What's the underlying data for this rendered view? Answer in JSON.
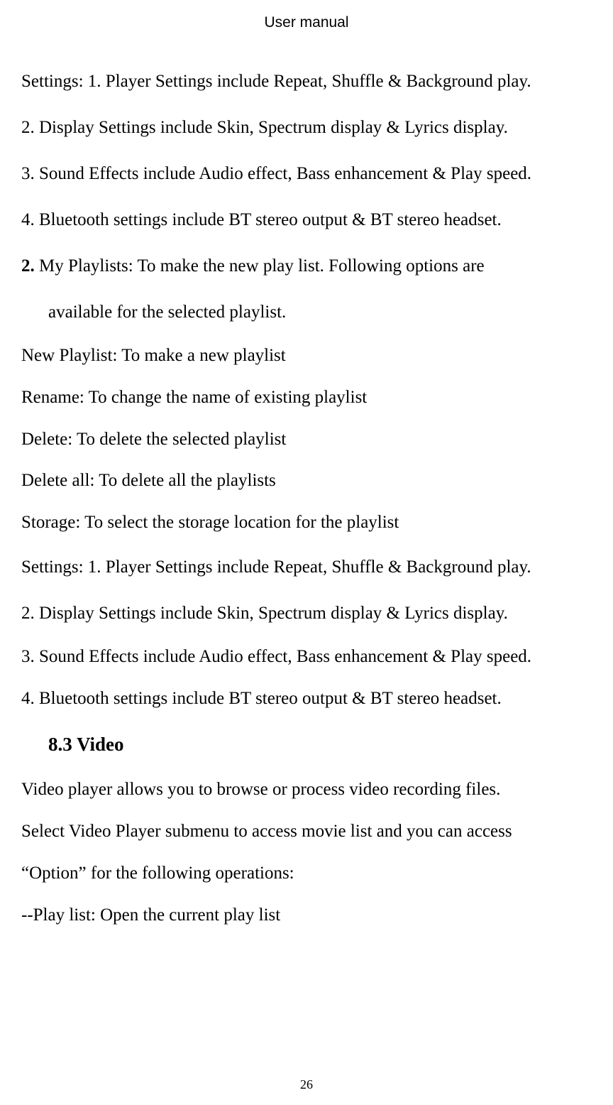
{
  "header": "User manual",
  "p1": "Settings: 1. Player Settings include Repeat, Shuffle & Background play.",
  "p2": "2. Display Settings include Skin, Spectrum display & Lyrics display.",
  "p3": "3. Sound Effects include Audio effect, Bass enhancement & Play speed.",
  "p4": "4. Bluetooth settings include BT stereo output & BT stereo headset.",
  "p5_prefix": "2.",
  "p5_rest": " My Playlists: To make the new play list. Following options are",
  "p5b": "available for the selected playlist.",
  "p6": "New Playlist: To make a new playlist",
  "p7": "Rename: To change the name of existing playlist",
  "p8": "Delete: To delete the selected playlist",
  "p9": "Delete all: To delete all the playlists",
  "p10": "Storage: To select the storage location for the playlist",
  "p11": "Settings: 1. Player Settings include Repeat, Shuffle & Background play.",
  "p12": "2. Display Settings include Skin, Spectrum display & Lyrics display.",
  "p13": "3. Sound Effects include Audio effect, Bass enhancement & Play speed.",
  "p14": "4. Bluetooth settings include BT stereo output & BT stereo headset.",
  "heading": "8.3 Video",
  "p15": "Video player allows you to browse or process video recording files.",
  "p16": "Select Video Player submenu to access movie list and you can access",
  "p17": "“Option” for the following operations:",
  "p18": "--Play list: Open the current play list",
  "page_number": "26"
}
